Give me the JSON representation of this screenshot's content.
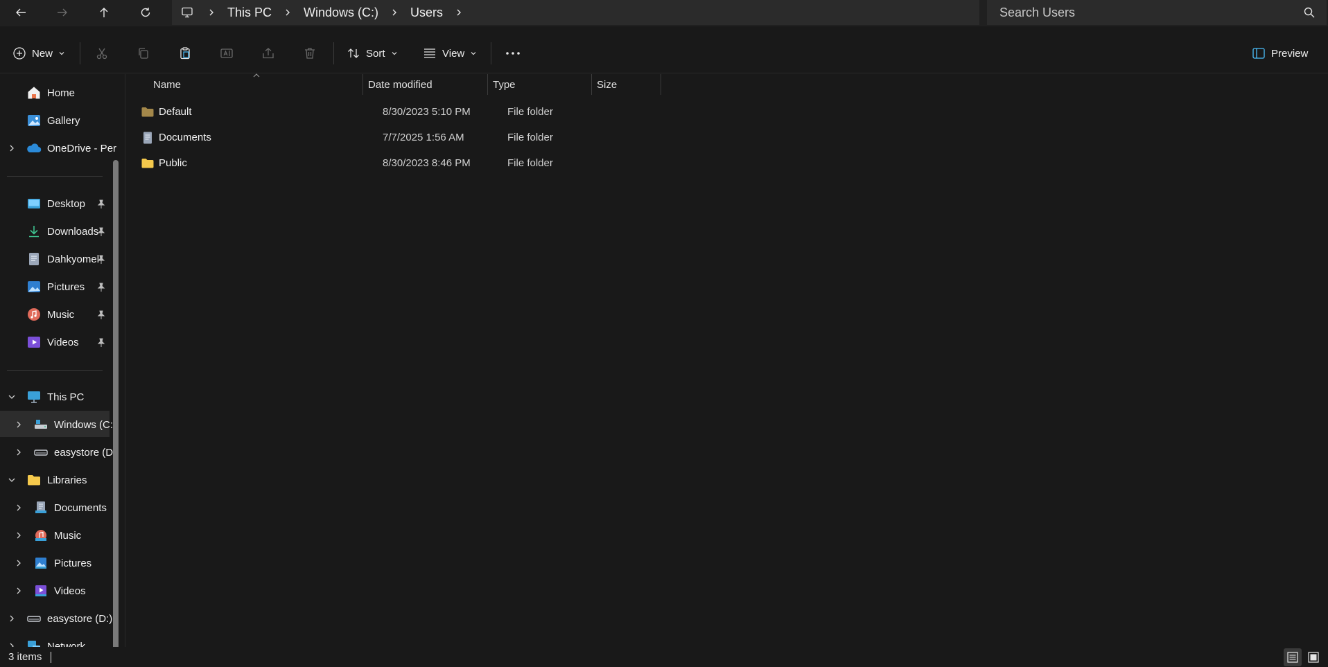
{
  "address": {
    "back_icon": "arrow-left-icon",
    "forward_icon": "arrow-right-icon",
    "up_icon": "arrow-up-icon",
    "refresh_icon": "refresh-icon",
    "breadcrumbs": [
      "This PC",
      "Windows (C:)",
      "Users"
    ],
    "search_placeholder": "Search Users"
  },
  "toolbar": {
    "new_label": "New",
    "sort_label": "Sort",
    "view_label": "View",
    "preview_label": "Preview"
  },
  "nav": {
    "home": "Home",
    "gallery": "Gallery",
    "onedrive": "OneDrive - Per",
    "desktop": "Desktop",
    "downloads": "Downloads",
    "dahkyomel": "Dahkyomel",
    "pictures": "Pictures",
    "music": "Music",
    "videos": "Videos",
    "this_pc": "This PC",
    "windows_c": "Windows (C:",
    "easystore_sub": "easystore (D:",
    "libraries": "Libraries",
    "lib_documents": "Documents",
    "lib_music": "Music",
    "lib_pictures": "Pictures",
    "lib_videos": "Videos",
    "easystore": "easystore (D:)",
    "network": "Network"
  },
  "columns": {
    "name": "Name",
    "date": "Date modified",
    "type": "Type",
    "size": "Size"
  },
  "files": [
    {
      "name": "Default",
      "date": "8/30/2023 5:10 PM",
      "type": "File folder",
      "size": "",
      "icon": "folder-dim-icon"
    },
    {
      "name": "Documents",
      "date": "7/7/2025 1:56 AM",
      "type": "File folder",
      "size": "",
      "icon": "documents-icon"
    },
    {
      "name": "Public",
      "date": "8/30/2023 8:46 PM",
      "type": "File folder",
      "size": "",
      "icon": "folder-icon"
    }
  ],
  "status": {
    "item_count": "3 items"
  },
  "colors": {
    "accent": "#4cc2ff",
    "folder": "#f5c94c",
    "background": "#191919"
  }
}
